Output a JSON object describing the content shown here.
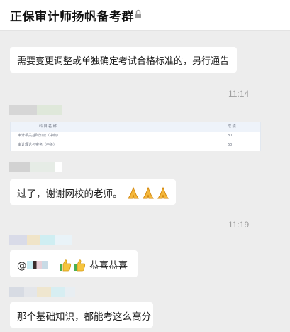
{
  "header": {
    "title": "正保审计师扬帆备考群",
    "icon": "lock-icon"
  },
  "messages": {
    "m1_text": "需要变更调整或单独确定考试合格标准的，另行通告",
    "time1": "11:14",
    "table": {
      "col1": "科 目 名 称",
      "col2": "成 绩",
      "rows": [
        {
          "subject": "审计相关基础知识（中级）",
          "score": "80"
        },
        {
          "subject": "审计理论与实务（中级）",
          "score": "60"
        }
      ]
    },
    "m3_text": "过了，谢谢网校的老师。",
    "time2": "11:19",
    "m4_at": "@",
    "m4_text": "恭喜恭喜",
    "m5_text": "那个基础知识，都能考这么高分"
  },
  "colors": {
    "background": "#ededed",
    "bubble": "#ffffff",
    "time": "#9e9e9e"
  }
}
